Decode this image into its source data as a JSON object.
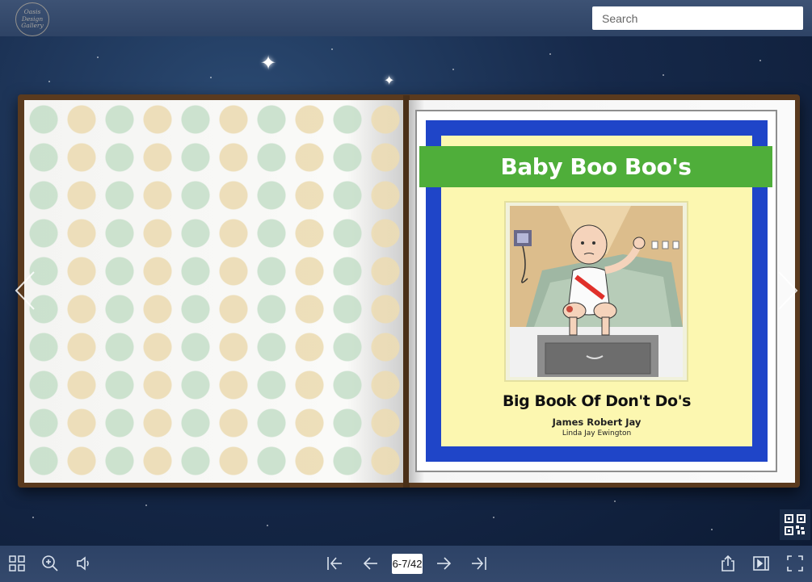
{
  "header": {
    "logo_text": [
      "Oasis",
      "Design",
      "Gallery"
    ],
    "search_placeholder": "Search"
  },
  "book": {
    "title": "Baby Boo Boo's",
    "subtitle": "Big Book Of Don't Do's",
    "author": "James Robert Jay",
    "illustrator": "Linda Jay Ewington",
    "colors": {
      "frame": "#5a3a1e",
      "cover_border": "#1f45c8",
      "cover_background": "#fcf7b0",
      "title_band": "#4fae3a"
    }
  },
  "navigation": {
    "prev_page_icon": "chevron-left-icon",
    "next_page_icon": "chevron-right-icon",
    "qr_icon": "qr-code-icon"
  },
  "toolbar": {
    "left": [
      "thumbnails-icon",
      "zoom-in-icon",
      "sound-icon"
    ],
    "center": [
      "first-page-icon",
      "prev-page-icon",
      "next-page-icon",
      "last-page-icon"
    ],
    "page_indicator": "6-7/42",
    "right": [
      "share-icon",
      "autoplay-icon",
      "fullscreen-icon"
    ]
  }
}
